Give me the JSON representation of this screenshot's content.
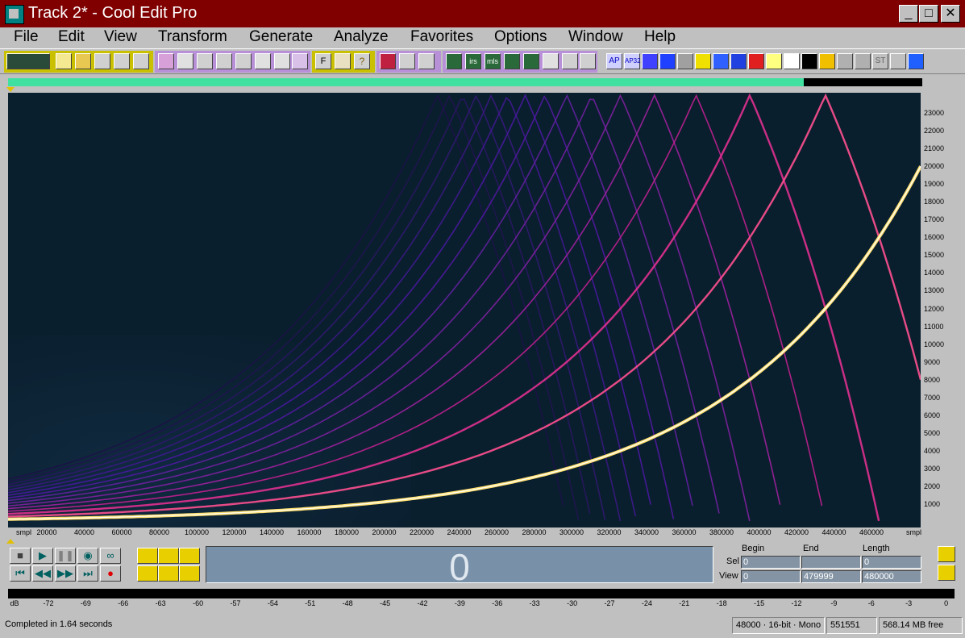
{
  "window": {
    "title": "Track 2* - Cool Edit Pro",
    "controls": {
      "minimize": "_",
      "maximize": "□",
      "close": "✕"
    }
  },
  "menu": [
    "File",
    "Edit",
    "View",
    "Transform",
    "Generate",
    "Analyze",
    "Favorites",
    "Options",
    "Window",
    "Help"
  ],
  "toolbar": {
    "text_buttons": {
      "f": "F",
      "help": "?",
      "ap": "AP",
      "ap32": "AP32",
      "st": "ST",
      "irs": "irs",
      "mls": "mls"
    }
  },
  "overview": {
    "visible_fraction": 0.87
  },
  "spectrogram": {
    "x_axis_label": "smpl",
    "x_axis_label_end": "smpl",
    "x_ticks": [
      "20000",
      "40000",
      "60000",
      "80000",
      "100000",
      "120000",
      "140000",
      "160000",
      "180000",
      "200000",
      "220000",
      "240000",
      "260000",
      "280000",
      "300000",
      "320000",
      "340000",
      "360000",
      "380000",
      "400000",
      "420000",
      "440000",
      "460000"
    ],
    "y_ticks": [
      "23000",
      "22000",
      "21000",
      "20000",
      "19000",
      "18000",
      "17000",
      "16000",
      "15000",
      "14000",
      "13000",
      "12000",
      "11000",
      "10000",
      "9000",
      "8000",
      "7000",
      "6000",
      "5000",
      "4000",
      "3000",
      "2000",
      "1000"
    ],
    "fundamental_end_hz": 20000
  },
  "time_display": {
    "value": "0"
  },
  "selection": {
    "headers": {
      "begin": "Begin",
      "end": "End",
      "length": "Length"
    },
    "rows": [
      {
        "label": "Sel",
        "begin": "0",
        "end": "",
        "length": "0"
      },
      {
        "label": "View",
        "begin": "0",
        "end": "479999",
        "length": "480000"
      }
    ]
  },
  "level_meter": {
    "unit": "dB",
    "ticks": [
      "-72",
      "-69",
      "-66",
      "-63",
      "-60",
      "-57",
      "-54",
      "-51",
      "-48",
      "-45",
      "-42",
      "-39",
      "-36",
      "-33",
      "-30",
      "-27",
      "-24",
      "-21",
      "-18",
      "-15",
      "-12",
      "-9",
      "-6",
      "-3",
      "0"
    ]
  },
  "status": {
    "message": "Completed in 1.64 seconds",
    "format": "48000 · 16-bit · Mono",
    "size": "551551",
    "free": "568.14 MB free"
  },
  "colors": {
    "title_bar": "#800000",
    "spectrogram_bg": "#0a1f2e",
    "overview_fill": "#40e0a0",
    "time_panel": "#7890a8"
  }
}
